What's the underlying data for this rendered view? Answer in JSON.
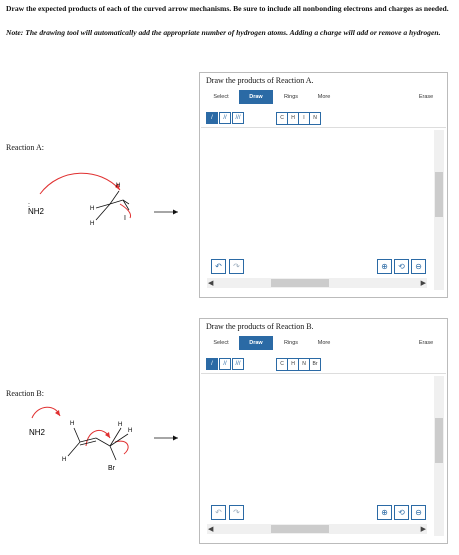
{
  "instructions": {
    "main": "Draw the expected products of each of the curved arrow mechanisms. Be sure to include all nonbonding electrons and charges as needed.",
    "note": "Note: The drawing tool will automatically add the appropriate number of hydrogen atoms. Adding a charge will add or remove a hydrogen."
  },
  "reactions": [
    {
      "label": "Reaction A:",
      "panel_title": "Draw the products of Reaction A.",
      "atoms": [
        "C",
        "H",
        "I",
        "N"
      ],
      "mol": {
        "nucleophile": "NH2",
        "leaving": "I",
        "h": "H"
      }
    },
    {
      "label": "Reaction B:",
      "panel_title": "Draw the products of Reaction B.",
      "atoms": [
        "C",
        "H",
        "N",
        "Br"
      ],
      "mol": {
        "nucleophile": "NH2",
        "leaving": "Br",
        "h": "H"
      }
    }
  ],
  "toolbar": {
    "select": "Select",
    "draw": "Draw",
    "rings": "Rings",
    "more": "More",
    "erase": "Erase",
    "bonds": [
      "/",
      "//",
      "///"
    ]
  },
  "icons": {
    "undo": "undo-icon",
    "redo": "redo-icon",
    "zoom_in": "zoom-in-icon",
    "zoom_reset": "zoom-reset-icon",
    "zoom_out": "zoom-out-icon"
  },
  "colors": {
    "accent": "#2b6aa5",
    "arrow": "#e03030"
  }
}
